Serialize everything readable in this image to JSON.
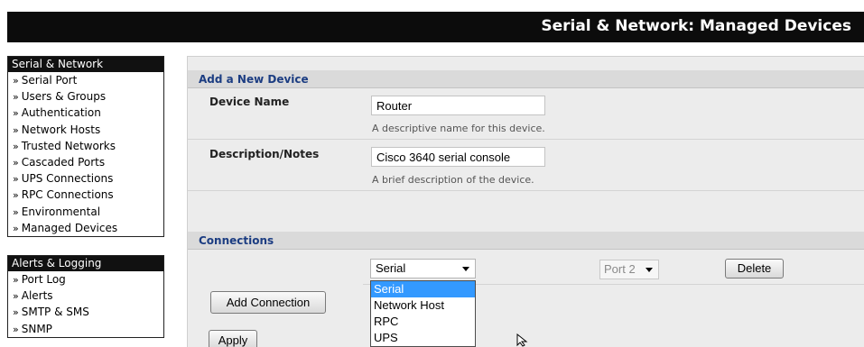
{
  "header": {
    "title": "Serial & Network: Managed Devices"
  },
  "sidebar": {
    "sections": [
      {
        "title": "Serial & Network",
        "items": [
          {
            "label": "Serial Port"
          },
          {
            "label": "Users & Groups"
          },
          {
            "label": "Authentication"
          },
          {
            "label": "Network Hosts"
          },
          {
            "label": "Trusted Networks"
          },
          {
            "label": "Cascaded Ports"
          },
          {
            "label": "UPS Connections"
          },
          {
            "label": "RPC Connections"
          },
          {
            "label": "Environmental"
          },
          {
            "label": "Managed Devices"
          }
        ]
      },
      {
        "title": "Alerts & Logging",
        "items": [
          {
            "label": "Port Log"
          },
          {
            "label": "Alerts"
          },
          {
            "label": "SMTP & SMS"
          },
          {
            "label": "SNMP"
          }
        ]
      }
    ],
    "bullet": "»"
  },
  "form": {
    "add_device_heading": "Add a New Device",
    "device_name": {
      "label": "Device Name",
      "value": "Router",
      "hint": "A descriptive name for this device."
    },
    "description": {
      "label": "Description/Notes",
      "value": "Cisco 3640 serial console",
      "hint": "A brief description of the device."
    },
    "connections_heading": "Connections",
    "connection_type": {
      "selected": "Serial",
      "options": [
        "Serial",
        "Network Host",
        "RPC",
        "UPS"
      ]
    },
    "port": {
      "selected": "Port 2"
    },
    "delete_label": "Delete",
    "add_connection_label": "Add Connection",
    "apply_label": "Apply"
  },
  "colors": {
    "header_bg": "#0c0c0c",
    "section_heading_text": "#1c3d82",
    "dropdown_highlight": "#3399ff"
  }
}
